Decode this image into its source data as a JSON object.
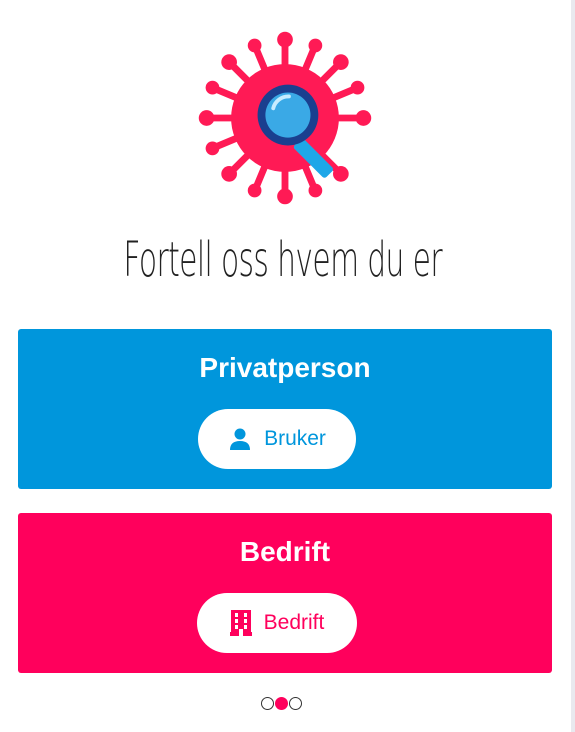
{
  "title": "Fortell oss hvem du er",
  "cards": {
    "private": {
      "heading": "Privatperson",
      "button_label": "Bruker",
      "icon": "user-icon",
      "color": "#0096dc"
    },
    "business": {
      "heading": "Bedrift",
      "button_label": "Bedrift",
      "icon": "building-icon",
      "color": "#ff005c"
    }
  },
  "pagination": {
    "total": 3,
    "active_index": 1
  },
  "logo": {
    "icon": "virus-magnifier-icon"
  }
}
